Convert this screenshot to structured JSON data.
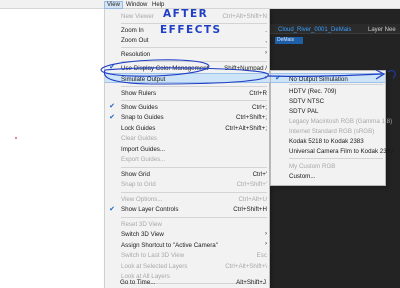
{
  "menubar": {
    "items": [
      "View",
      "Window",
      "Help"
    ]
  },
  "background": {
    "tab_title": "Cloud_River_0001_DeMais",
    "layer_label": "Layer Nee",
    "chip_label": "DeMais"
  },
  "view_menu": {
    "items": [
      {
        "label": "New Viewer",
        "shortcut": "Ctrl+Alt+Shift+N",
        "disabled": true
      },
      {
        "label": "Zoom In",
        "shortcut": "."
      },
      {
        "label": "Zoom Out",
        "shortcut": ","
      },
      {
        "label": "Resolution",
        "submenu": true
      },
      {
        "label": "Use Display Color Management",
        "shortcut": "Shift+Numpad /",
        "checked": true
      },
      {
        "label": "Simulate Output",
        "submenu": true,
        "highlighted": true
      },
      {
        "label": "Show Rulers",
        "shortcut": "Ctrl+R"
      },
      {
        "label": "Show Guides",
        "shortcut": "Ctrl+;",
        "checked": true
      },
      {
        "label": "Snap to Guides",
        "shortcut": "Ctrl+Shift+;",
        "checked": true
      },
      {
        "label": "Lock Guides",
        "shortcut": "Ctrl+Alt+Shift+;"
      },
      {
        "label": "Clear Guides",
        "disabled": true
      },
      {
        "label": "Import Guides..."
      },
      {
        "label": "Export Guides...",
        "disabled": true
      },
      {
        "label": "Show Grid",
        "shortcut": "Ctrl+'"
      },
      {
        "label": "Snap to Grid",
        "shortcut": "Ctrl+Shift+'",
        "disabled": true
      },
      {
        "label": "View Options...",
        "shortcut": "Ctrl+Alt+U",
        "disabled": true
      },
      {
        "label": "Show Layer Controls",
        "shortcut": "Ctrl+Shift+H",
        "checked": true
      },
      {
        "label": "Reset 3D View",
        "disabled": true
      },
      {
        "label": "Switch 3D View",
        "submenu": true
      },
      {
        "label": "Assign Shortcut to \"Active Camera\"",
        "submenu": true
      },
      {
        "label": "Switch to Last 3D View",
        "shortcut": "Esc",
        "disabled": true
      },
      {
        "label": "Look at Selected Layers",
        "shortcut": "Ctrl+Alt+Shift+\\",
        "disabled": true
      },
      {
        "label": "Look at All Layers",
        "disabled": true
      },
      {
        "label": "Go to Time...",
        "shortcut": "Alt+Shift+J"
      }
    ]
  },
  "simulate_output_submenu": {
    "items": [
      {
        "label": "No Output Simulation",
        "checked": true,
        "highlighted": true
      },
      {
        "label": "HDTV (Rec. 709)"
      },
      {
        "label": "SDTV NTSC"
      },
      {
        "label": "SDTV PAL"
      },
      {
        "label": "Legacy Macintosh RGB (Gamma 1.8)",
        "disabled": true
      },
      {
        "label": "Internet Standard RGB (sRGB)",
        "disabled": true
      },
      {
        "label": "Kodak 5218 to Kodak 2383"
      },
      {
        "label": "Universal Camera Film to Kodak 2383"
      },
      {
        "label": "My Custom RGB",
        "disabled": true
      },
      {
        "label": "Custom..."
      }
    ]
  },
  "annotation": {
    "line1": "AFTER",
    "line2": "EFFECTS"
  },
  "colors": {
    "highlight": "#cde3f7",
    "check": "#1b64c4",
    "annotation": "#1f3fc4",
    "tab_text": "#3aa0ff"
  }
}
